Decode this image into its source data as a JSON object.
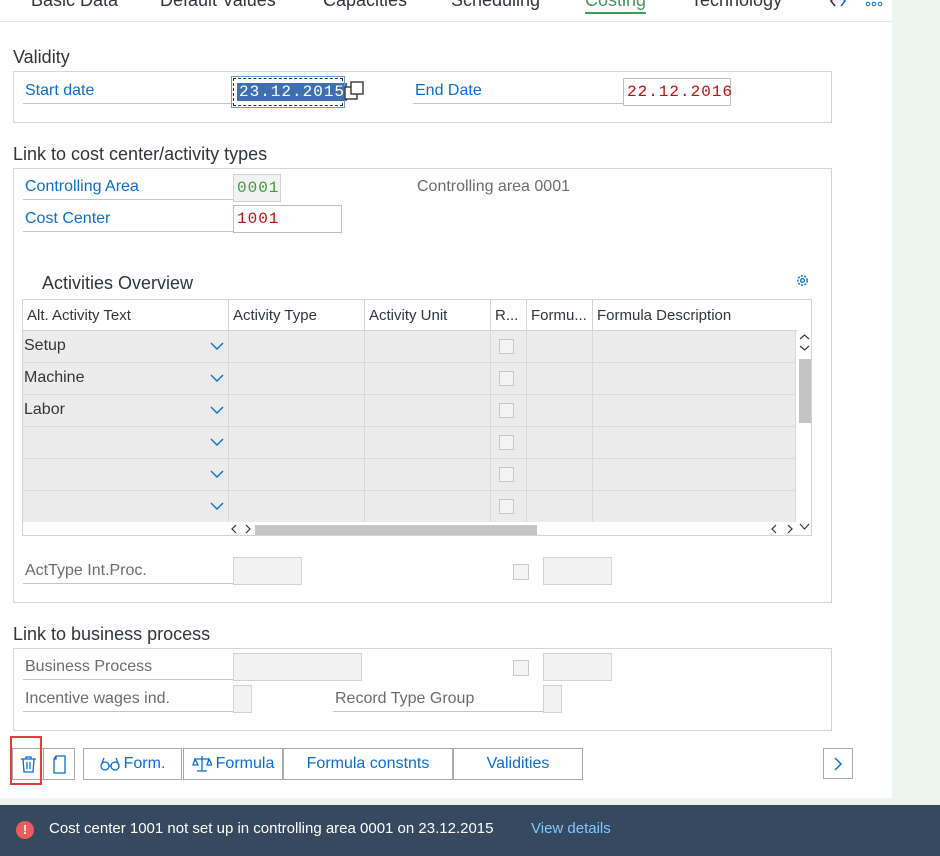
{
  "tabs": [
    "Basic Data",
    "Default Values",
    "Capacities",
    "Scheduling",
    "Costing",
    "Technology"
  ],
  "tab_more_icon": "chevron-left-right-icon",
  "overflow_icon": "more-dots-icon",
  "validity": {
    "title": "Validity",
    "start_label": "Start date",
    "start_value": "23.12.2015",
    "end_label": "End Date",
    "end_value": "22.12.2016"
  },
  "link_cost": {
    "title": "Link to cost center/activity types",
    "ca_label": "Controlling Area",
    "ca_value": "0001",
    "ca_desc": "Controlling area 0001",
    "cc_label": "Cost Center",
    "cc_value": "1001"
  },
  "activities": {
    "title": "Activities Overview",
    "settings_icon": "gear-icon",
    "columns": [
      "Alt. Activity Text",
      "Activity Type",
      "Activity Unit",
      "R...",
      "Formu...",
      "Formula Description"
    ],
    "rows": [
      "Setup",
      "Machine",
      "Labor",
      "",
      "",
      ""
    ]
  },
  "acttype": {
    "label": "ActType Int.Proc."
  },
  "business": {
    "title": "Link to business process",
    "bp_label": "Business Process",
    "inc_label": "Incentive wages ind.",
    "rtg_label": "Record Type Group"
  },
  "buttons": {
    "form": "Form.",
    "formula": "Formula",
    "formula_constnts": "Formula constnts",
    "validities": "Validities"
  },
  "message": {
    "text": "Cost center 1001 not set up in controlling area 0001 on 23.12.2015",
    "link": "View details",
    "status_color": "#f05a5a"
  },
  "colors": {
    "accent": "#0a6ed1",
    "active_tab": "#3f9b5a",
    "error": "#c01010",
    "bar": "#354a5f"
  }
}
